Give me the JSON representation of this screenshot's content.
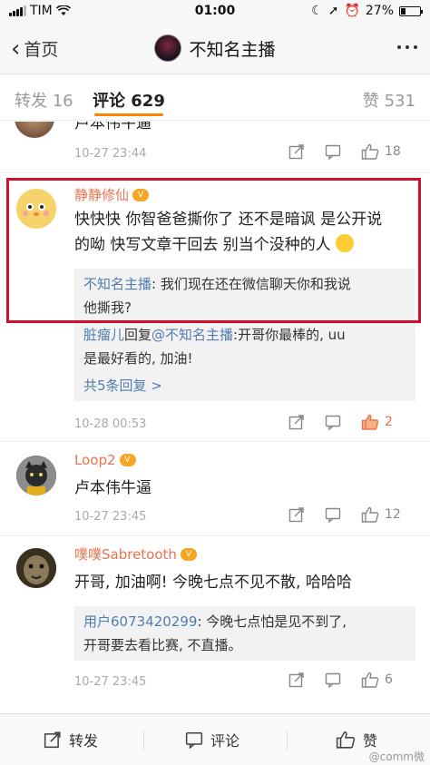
{
  "status_bar": {
    "carrier": "TIM",
    "time": "01:00",
    "battery": "27%",
    "battery_level": 0.27
  },
  "nav": {
    "back_label": "首页",
    "title": "不知名主播"
  },
  "tabs": {
    "repost": "转发 16",
    "comment": "评论 629",
    "like": "赞 531"
  },
  "comments": [
    {
      "text": "卢本伟牛逼",
      "time": "10-27 23:44",
      "likes": "18"
    },
    {
      "user": "静静修仙",
      "text_line1": "快快快 你智爸爸撕你了 还不是暗讽 是公开说",
      "text_line2": "的呦 快写文章干回去 别当个没种的人",
      "reply1_name": "不知名主播",
      "reply1_text_a": ": 我们现在还在微信聊天你和我说",
      "reply1_text_b": "他撕我?",
      "reply2_name": "脏瘤儿",
      "reply2_mid": "回复",
      "reply2_at": "@不知名主播",
      "reply2_text_a": ":开哥你最棒的, uu",
      "reply2_text_b": "是最好看的, 加油!",
      "more_replies": "共5条回复 >",
      "time": "10-28 00:53",
      "likes": "2"
    },
    {
      "user": "Loop2",
      "text": "卢本伟牛逼",
      "time": "10-27 23:45",
      "likes": "12"
    },
    {
      "user": "噗噗Sabretooth",
      "text": "开哥, 加油啊! 今晚七点不见不散, 哈哈哈",
      "reply_name": "用户6073420299",
      "reply_text_a": ": 今晚七点怕是见不到了,",
      "reply_text_b": "开哥要去看比赛, 不直播。",
      "time": "10-27 23:45",
      "likes": "6"
    }
  ],
  "bottom_bar": {
    "repost": "转发",
    "comment": "评论",
    "like": "赞",
    "watermark": "@comm微"
  },
  "colors": {
    "accent_orange": "#ff8200",
    "username": "#eb7350",
    "link_blue": "#507daf",
    "highlight_red": "#d0102a"
  }
}
